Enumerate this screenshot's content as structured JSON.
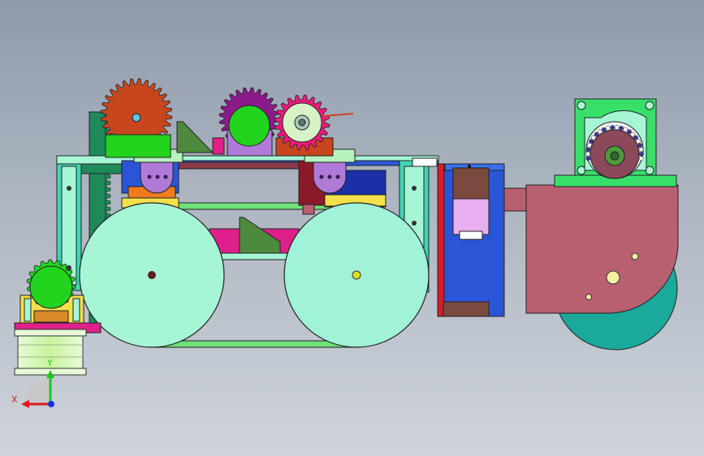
{
  "viewport": {
    "background_top": "#8f9aaa",
    "background_bottom": "#cfd4da"
  },
  "triad": {
    "x_label": "X",
    "y_label": "Y",
    "x_color": "#d81b1b",
    "y_color": "#1ec61e",
    "z_color": "#1a2fd1"
  },
  "model": {
    "colors": {
      "wheel": "#a6f6d6",
      "wheel_front": "#a0f2d8",
      "gear_orange": "#c8461e",
      "gear_purple": "#8a1a8a",
      "gear_pink": "#ef1a7a",
      "gear_green": "#22d41e",
      "frame_green": "#6fe07a",
      "mount_green": "#38e06a",
      "rail_cyan": "#3fd6b4",
      "motor_purple": "#b07ad8",
      "housing_blue": "#2a55d6",
      "housing_dark": "#1a2fa8",
      "block_maroon": "#b86070",
      "disk_teal": "#1aa99a",
      "bracket_magenta": "#e0208a",
      "bracket_olive": "#4e8a3e",
      "rack_green": "#1e8a5a",
      "accent_yellow": "#f4e04a"
    }
  }
}
